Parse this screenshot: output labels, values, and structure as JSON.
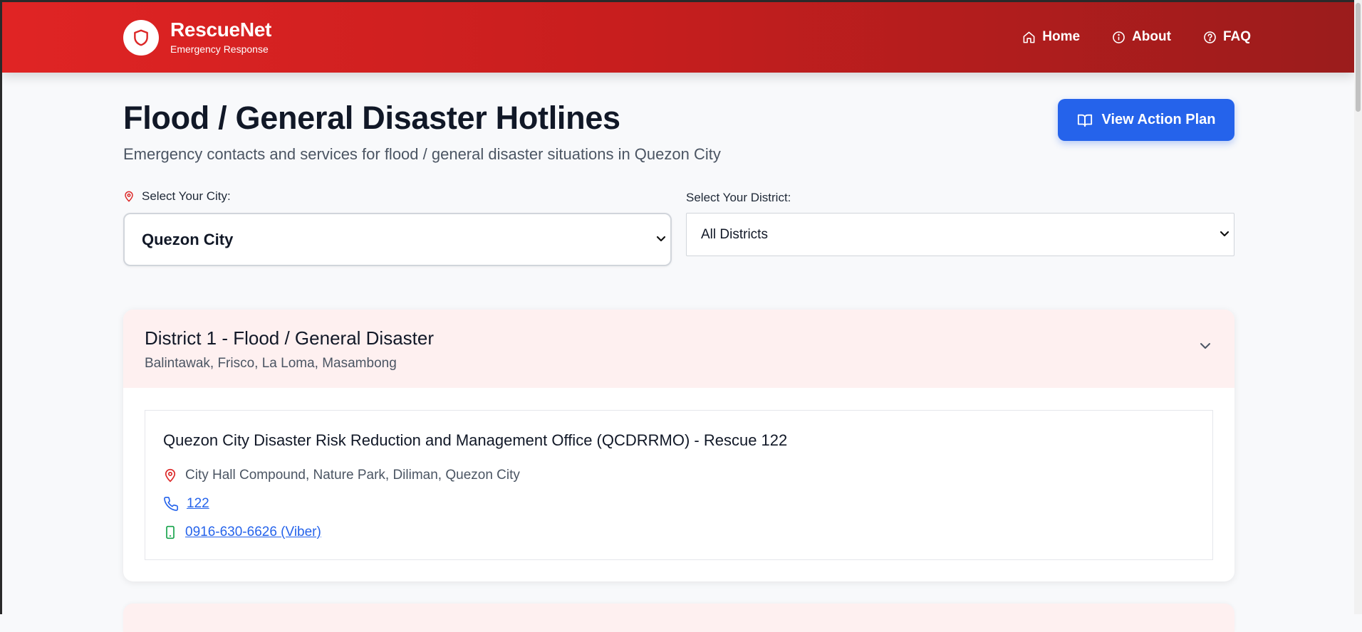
{
  "brand": {
    "name": "RescueNet",
    "tagline": "Emergency Response",
    "logo_icon": "shield-icon"
  },
  "nav": [
    {
      "label": "Home",
      "icon": "home-icon"
    },
    {
      "label": "About",
      "icon": "info-icon"
    },
    {
      "label": "FAQ",
      "icon": "help-circle-icon"
    }
  ],
  "page": {
    "title": "Flood / General Disaster Hotlines",
    "subtitle": "Emergency contacts and services for flood / general disaster situations in Quezon City",
    "action_button": "View Action Plan"
  },
  "filters": {
    "city_label": "Select Your City:",
    "city_value": "Quezon City",
    "district_label": "Select Your District:",
    "district_value": "All Districts"
  },
  "district_card": {
    "title": "District 1 - Flood / General Disaster",
    "barangays": "Balintawak, Frisco, La Loma, Masambong",
    "contact": {
      "name": "Quezon City Disaster Risk Reduction and Management Office (QCDRRMO) - Rescue 122",
      "address": "City Hall Compound, Nature Park, Diliman, Quezon City",
      "phone": "122",
      "mobile": "0916-630-6626 (Viber)"
    }
  },
  "colors": {
    "header_start": "#e02424",
    "header_end": "#9b1c1c",
    "accent_blue": "#2563eb",
    "card_header_bg": "#fef0f0",
    "pin_red": "#dc2626",
    "mobile_green": "#16a34a"
  }
}
